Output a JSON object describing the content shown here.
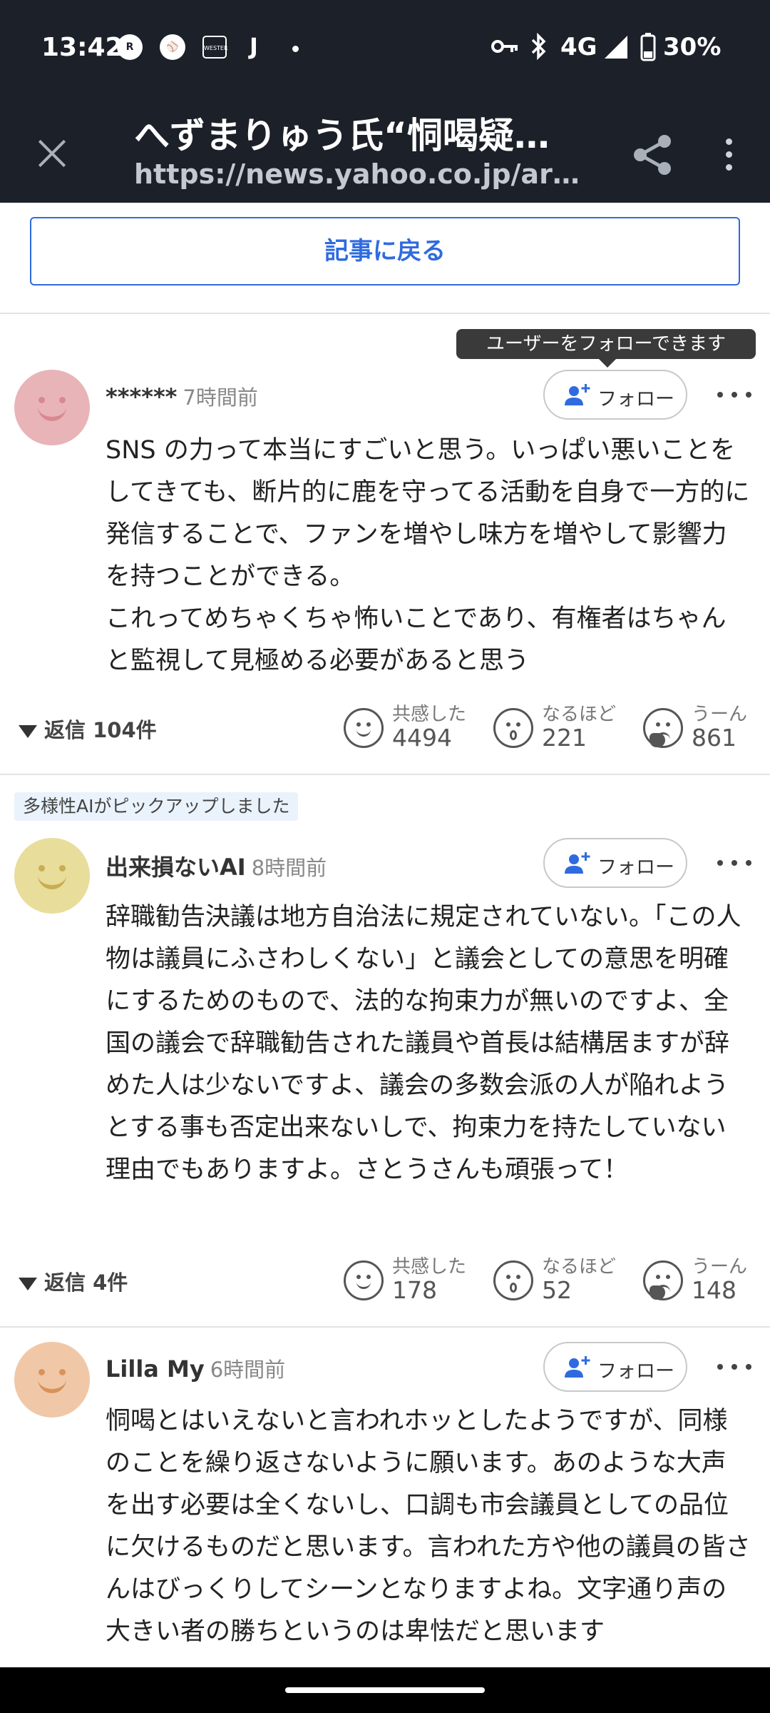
{
  "status_bar": {
    "time": "13:42",
    "icons": [
      "rakuten-link-icon",
      "baseball-icon",
      "wester-icon"
    ],
    "wester_label": "WESTER",
    "rakuten_label": "R",
    "j_label": "J",
    "network": "4G",
    "battery": "30%"
  },
  "browser": {
    "title": "へずまりゅう氏“恫喝疑…",
    "url": "https://news.yahoo.co.jp/article…"
  },
  "back_button": "記事に戻る",
  "tooltip": "ユーザーをフォローできます",
  "follow_label": "フォロー",
  "ai_pick_label": "多様性AIがピックアップしました",
  "reaction_labels": [
    "共感した",
    "なるほど",
    "うーん"
  ],
  "comments": [
    {
      "author": "******",
      "time_ago": "7時間前",
      "avatar_color": "#e8b4b8",
      "avatar_feature_color": "#d98890",
      "text": "SNS の力って本当にすごいと思う。いっぱい悪いことをしてきても、断片的に鹿を守ってる活動を自身で一方的に発信することで、ファンを増やし味方を増やして影響力を持つことができる。\nこれってめちゃくちゃ怖いことであり、有権者はちゃんと監視して見極める必要があると思う",
      "replies": "返信 104件",
      "reactions": [
        "4494",
        "221",
        "861"
      ]
    },
    {
      "author": "出来損ないAI",
      "time_ago": "8時間前",
      "avatar_color": "#e8dd9a",
      "avatar_feature_color": "#c9ad52",
      "text": "辞職勧告決議は地方自治法に規定されていない。「この人物は議員にふさわしくない」と議会としての意思を明確にするためのもので、法的な拘束力が無いのですよ、全国の議会で辞職勧告された議員や首長は結構居ますが辞めた人は少ないですよ、議会の多数会派の人が陥れようとする事も否定出来ないしで、拘束力を持たしていない理由でもありますよ。さとうさんも頑張って！",
      "replies": "返信 4件",
      "reactions": [
        "178",
        "52",
        "148"
      ]
    },
    {
      "author": "Lilla My",
      "time_ago": "6時間前",
      "avatar_color": "#f0c8a8",
      "avatar_feature_color": "#d9925a",
      "text": "恫喝とはいえないと言われホッとしたようですが、同様のことを繰り返さないように願います。あのような大声を出す必要は全くないし、口調も市会議員としての品位に欠けるものだと思います。言われた方や他の議員の皆さんはびっくりしてシーンとなりますよね。文字通り声の大きい者の勝ちというのは卑怯だと思います"
    }
  ]
}
